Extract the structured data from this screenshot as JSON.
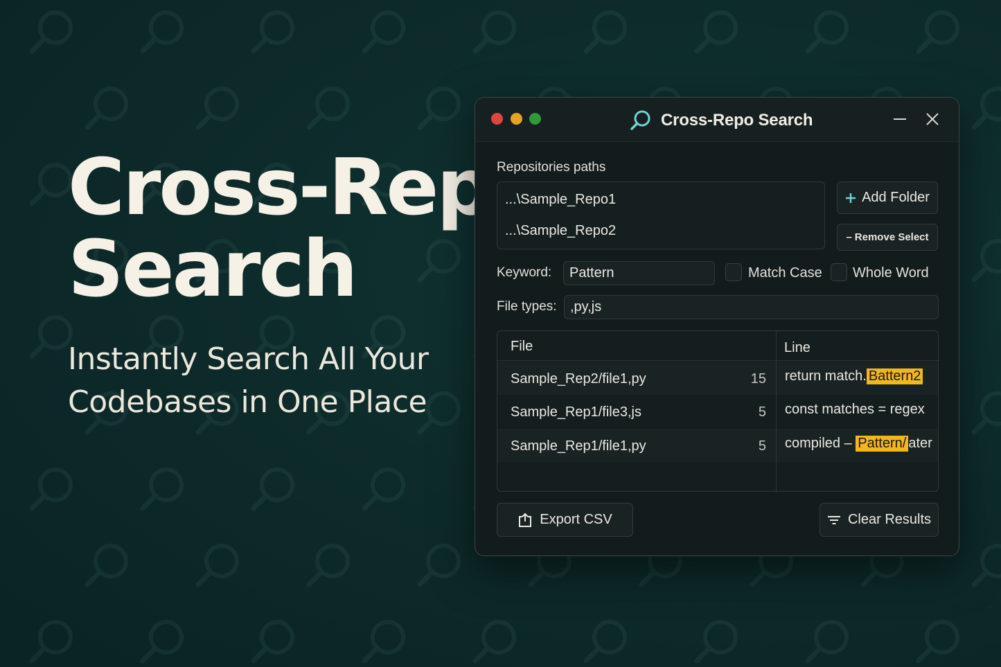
{
  "hero": {
    "title_line1": "Cross-Repo",
    "title_line2": "Search",
    "subtitle_line1": "Instantly Search All Your",
    "subtitle_line2": "Codebases in One Place"
  },
  "window": {
    "title": "Cross-Repo Search",
    "repos_label": "Repositories paths",
    "repos": [
      "...\\Sample_Repo1",
      "...\\Sample_Repo2"
    ],
    "add_folder_label": "Add Folder",
    "remove_select_label": "Remove Select",
    "keyword_label": "Keyword:",
    "keyword_value": "Pattern",
    "match_case_label": "Match Case",
    "whole_word_label": "Whole Word",
    "file_types_label": "File types:",
    "file_types_value": ",py,js",
    "table": {
      "col_file": "File",
      "col_line": "Line",
      "rows": [
        {
          "file": "Sample_Rep2/file1,py",
          "line": "15",
          "text_before": "return match.",
          "highlight": "Battern2",
          "text_after": ""
        },
        {
          "file": "Sample_Rep1/file3,js",
          "line": "5",
          "text_before": "const matches = regex",
          "highlight": "",
          "text_after": ""
        },
        {
          "file": "Sample_Rep1/file1,py",
          "line": "5",
          "text_before": "compiled – ",
          "highlight": "Pattern/",
          "text_after": "ater"
        }
      ]
    },
    "export_label": "Export CSV",
    "clear_label": "Clear Results"
  },
  "colors": {
    "background": "#0d2a2a",
    "highlight": "#f2b620",
    "accent_icon": "#6fd3d6"
  },
  "icons": [
    "search-icon",
    "minimize-icon",
    "close-icon",
    "plus-icon",
    "export-icon",
    "filter-icon"
  ]
}
